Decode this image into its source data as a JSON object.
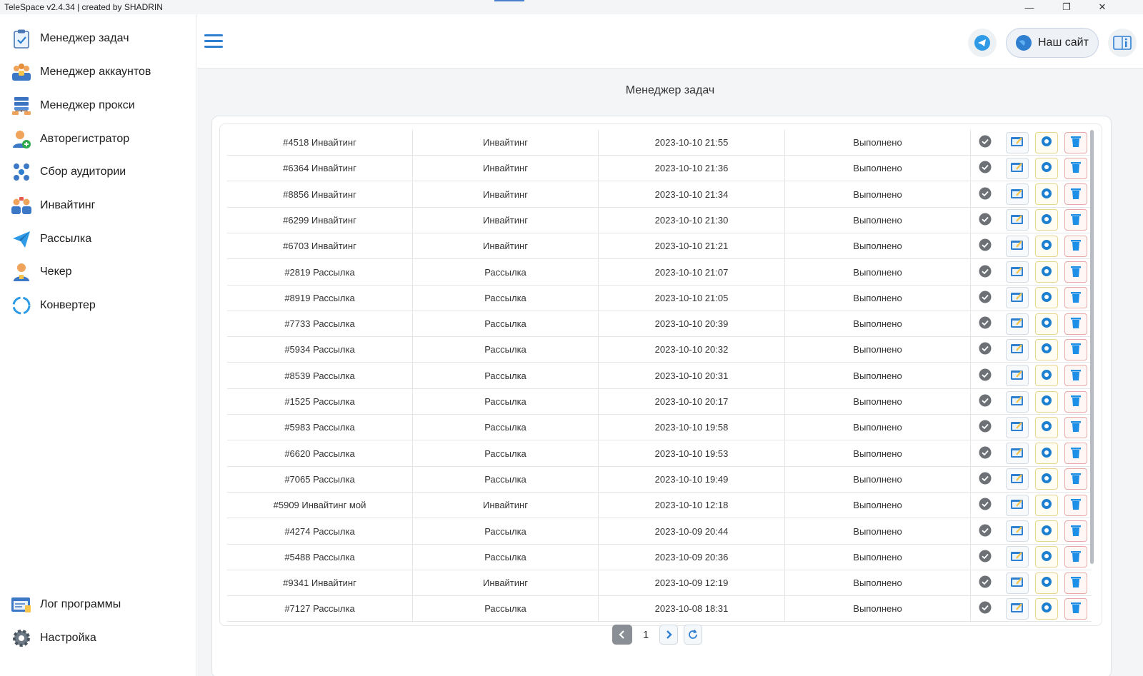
{
  "window": {
    "title": "TeleSpace v2.4.34 | created by SHADRIN",
    "minimize": "—",
    "restore": "❐",
    "close": "✕"
  },
  "sidebar": {
    "items": [
      {
        "label": "Менеджер задач",
        "icon": "clipboard-check-icon"
      },
      {
        "label": "Менеджер аккаунтов",
        "icon": "accounts-icon"
      },
      {
        "label": "Менеджер прокси",
        "icon": "proxy-servers-icon"
      },
      {
        "label": "Авторегистратор",
        "icon": "user-add-icon"
      },
      {
        "label": "Сбор аудитории",
        "icon": "audience-icon"
      },
      {
        "label": "Инвайтинг",
        "icon": "inviting-icon"
      },
      {
        "label": "Рассылка",
        "icon": "paper-plane-icon"
      },
      {
        "label": "Чекер",
        "icon": "user-check-icon"
      },
      {
        "label": "Конвертер",
        "icon": "convert-circle-icon"
      }
    ],
    "bottom_items": [
      {
        "label": "Лог программы",
        "icon": "log-icon"
      },
      {
        "label": "Настройка",
        "icon": "gear-icon"
      }
    ]
  },
  "header": {
    "site_button": "Наш сайт"
  },
  "page": {
    "title": "Менеджер задач"
  },
  "tasks": [
    {
      "name": "#4518 Инвайтинг",
      "type": "Инвайтинг",
      "date": "2023-10-10 21:55",
      "status": "Выполнено"
    },
    {
      "name": "#6364 Инвайтинг",
      "type": "Инвайтинг",
      "date": "2023-10-10 21:36",
      "status": "Выполнено"
    },
    {
      "name": "#8856 Инвайтинг",
      "type": "Инвайтинг",
      "date": "2023-10-10 21:34",
      "status": "Выполнено"
    },
    {
      "name": "#6299 Инвайтинг",
      "type": "Инвайтинг",
      "date": "2023-10-10 21:30",
      "status": "Выполнено"
    },
    {
      "name": "#6703 Инвайтинг",
      "type": "Инвайтинг",
      "date": "2023-10-10 21:21",
      "status": "Выполнено"
    },
    {
      "name": "#2819 Рассылка",
      "type": "Рассылка",
      "date": "2023-10-10 21:07",
      "status": "Выполнено"
    },
    {
      "name": "#8919 Рассылка",
      "type": "Рассылка",
      "date": "2023-10-10 21:05",
      "status": "Выполнено"
    },
    {
      "name": "#7733 Рассылка",
      "type": "Рассылка",
      "date": "2023-10-10 20:39",
      "status": "Выполнено"
    },
    {
      "name": "#5934 Рассылка",
      "type": "Рассылка",
      "date": "2023-10-10 20:32",
      "status": "Выполнено"
    },
    {
      "name": "#8539 Рассылка",
      "type": "Рассылка",
      "date": "2023-10-10 20:31",
      "status": "Выполнено"
    },
    {
      "name": "#1525 Рассылка",
      "type": "Рассылка",
      "date": "2023-10-10 20:17",
      "status": "Выполнено"
    },
    {
      "name": "#5983 Рассылка",
      "type": "Рассылка",
      "date": "2023-10-10 19:58",
      "status": "Выполнено"
    },
    {
      "name": "#6620 Рассылка",
      "type": "Рассылка",
      "date": "2023-10-10 19:53",
      "status": "Выполнено"
    },
    {
      "name": "#7065 Рассылка",
      "type": "Рассылка",
      "date": "2023-10-10 19:49",
      "status": "Выполнено"
    },
    {
      "name": "#5909 Инвайтинг мой",
      "type": "Инвайтинг",
      "date": "2023-10-10 12:18",
      "status": "Выполнено"
    },
    {
      "name": "#4274 Рассылка",
      "type": "Рассылка",
      "date": "2023-10-09 20:44",
      "status": "Выполнено"
    },
    {
      "name": "#5488 Рассылка",
      "type": "Рассылка",
      "date": "2023-10-09 20:36",
      "status": "Выполнено"
    },
    {
      "name": "#9341 Инвайтинг",
      "type": "Инвайтинг",
      "date": "2023-10-09 12:19",
      "status": "Выполнено"
    },
    {
      "name": "#7127 Рассылка",
      "type": "Рассылка",
      "date": "2023-10-08 18:31",
      "status": "Выполнено"
    }
  ],
  "pagination": {
    "current_page": "1"
  },
  "colors": {
    "accent": "#2f7fd1",
    "edit_border": "#d5dbe2",
    "view_border": "#e8d68e",
    "delete_border": "#e8a9a9",
    "delete_icon": "#1e8fe6"
  }
}
